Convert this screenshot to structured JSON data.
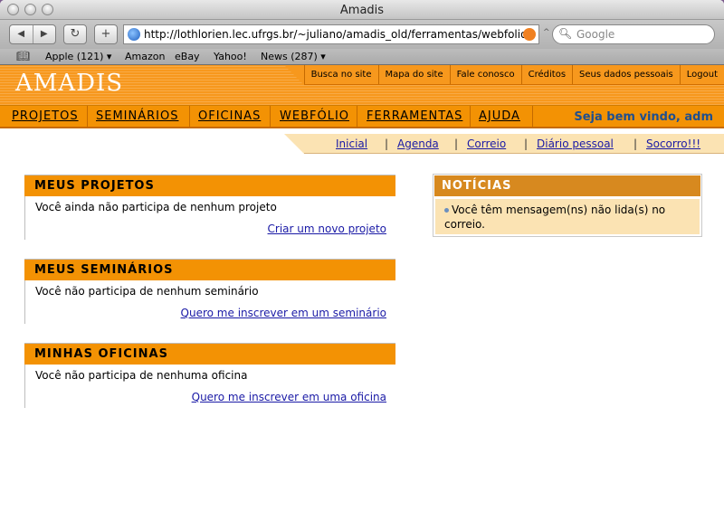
{
  "window": {
    "title": "Amadis"
  },
  "toolbar": {
    "url": "http://lothlorien.lec.ufrgs.br/~juliano/amadis_old/ferramentas/webfolio/w",
    "search_placeholder": "Google"
  },
  "bookmarks": [
    "Apple (121) ▾",
    "Amazon",
    "eBay",
    "Yahoo!",
    "News (287) ▾"
  ],
  "site": {
    "logo": "AMADIS",
    "top_links": [
      "Busca no site",
      "Mapa do site",
      "Fale conosco",
      "Créditos",
      "Seus dados pessoais",
      "Logout"
    ],
    "nav": [
      "PROJETOS",
      "SEMINÁRIOS",
      "OFICINAS",
      "WEBFÓLIO",
      "FERRAMENTAS",
      "AJUDA"
    ],
    "welcome": "Seja bem vindo, adm",
    "subnav": [
      "Inicial",
      "Agenda",
      "Correio",
      "Diário pessoal",
      "Socorro!!!"
    ]
  },
  "boxes": [
    {
      "title": "MEUS PROJETOS",
      "message": "Você ainda não participa de nenhum projeto",
      "action": "Criar um novo projeto"
    },
    {
      "title": "MEUS SEMINÁRIOS",
      "message": "Você não participa de nenhum seminário",
      "action": "Quero me inscrever em um seminário"
    },
    {
      "title": "MINHAS OFICINAS",
      "message": "Você não participa de nenhuma oficina",
      "action": "Quero me inscrever em uma oficina"
    }
  ],
  "news": {
    "title": "NOTÍCIAS",
    "line1": "Você têm  mensagem(ns) não lida(s) no",
    "line2": "correio."
  }
}
